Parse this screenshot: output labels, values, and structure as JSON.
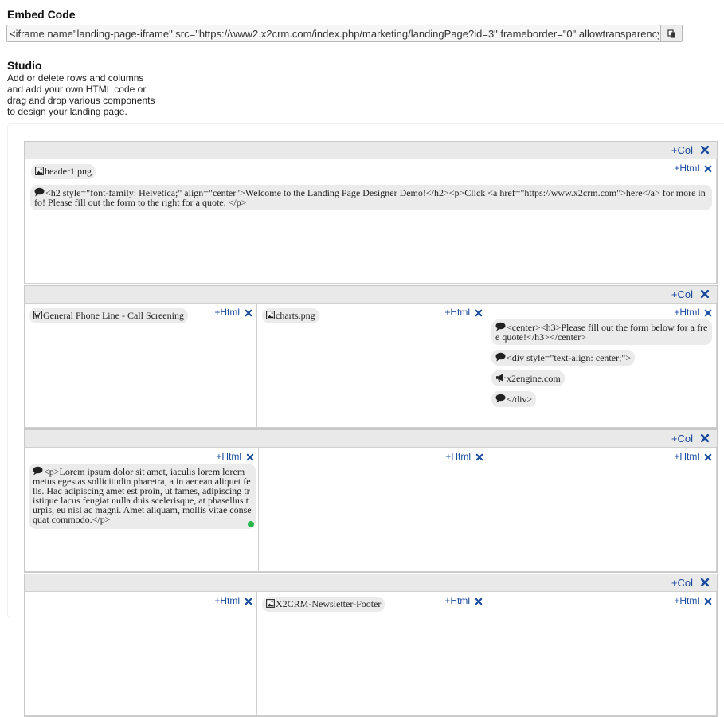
{
  "embed": {
    "title": "Embed Code",
    "code": "<iframe name\"landing-page-iframe\" src=\"https://www2.x2crm.com/index.php/marketing/landingPage?id=3\" frameborder=\"0\" allowtransparency=\"true\"></iframe>"
  },
  "studio": {
    "title": "Studio",
    "description_lines": [
      "Add or delete rows and columns",
      "and add your own HTML code or",
      "drag and drop various components",
      "to design your landing page."
    ]
  },
  "controls": {
    "add_col": "+Col",
    "add_html": "+Html"
  },
  "rows": [
    {
      "columns": [
        {
          "components": [
            {
              "icon": "image-icon",
              "label": "header1.png"
            },
            {
              "icon": "comment-icon",
              "label": "<h2 style=\"font-family: Helvetica;\" align=\"center\">Welcome to the Landing Page Designer Demo!</h2><p>Click <a href=\"https://www.x2crm.com\">here</a> for more info! Please fill out the form to the right for a quote. </p>"
            }
          ]
        }
      ]
    },
    {
      "columns": [
        {
          "components": [
            {
              "icon": "web-form-icon",
              "label": "General Phone Line - Call Screening"
            }
          ]
        },
        {
          "components": [
            {
              "icon": "image-icon",
              "label": "charts.png"
            }
          ]
        },
        {
          "components": [
            {
              "icon": "comment-icon",
              "label": "<center><h3>Please fill out the form below for a free quote!</h3></center>"
            },
            {
              "icon": "comment-icon",
              "label": "<div style=\"text-align: center;\">"
            },
            {
              "icon": "megaphone-icon",
              "label": "x2engine.com"
            },
            {
              "icon": "comment-icon",
              "label": "</div>"
            }
          ]
        }
      ]
    },
    {
      "columns": [
        {
          "components": [
            {
              "icon": "comment-icon",
              "label": "<p>Lorem ipsum dolor sit amet, iaculis lorem lorem metus egestas sollicitudin pharetra, a in aenean aliquet felis. Hac adipiscing amet est proin, ut fames, adipiscing tristique lacus feugiat nulla duis scelerisque, at phasellus turpis, eu nisl ac magni. Amet aliquam, mollis vitae consequat commodo.</p>"
            }
          ]
        },
        {
          "components": []
        },
        {
          "components": []
        }
      ]
    },
    {
      "columns": [
        {
          "components": []
        },
        {
          "components": [
            {
              "icon": "image-icon",
              "label": "X2CRM-Newsletter-Footer"
            }
          ]
        },
        {
          "components": []
        }
      ]
    }
  ]
}
